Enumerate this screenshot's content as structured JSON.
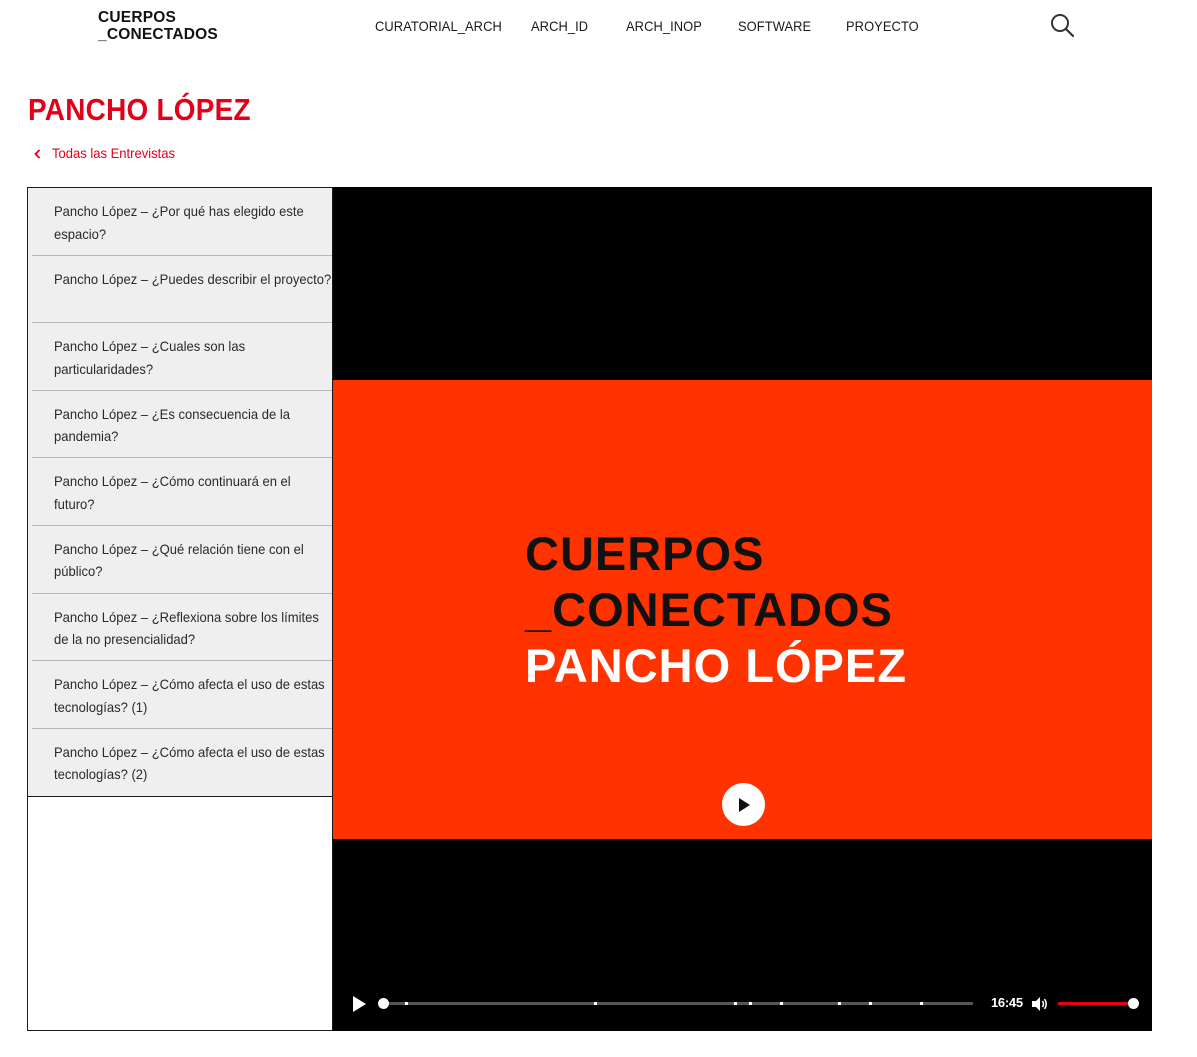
{
  "header": {
    "logo_line1": "CUERPOS",
    "logo_line2": "_CONECTADOS",
    "nav": [
      "CURATORIAL_ARCH",
      "ARCH_ID",
      "ARCH_INOP",
      "SOFTWARE",
      "PROYECTO"
    ],
    "search_icon": "search-icon"
  },
  "page": {
    "title": "PANCHO LÓPEZ",
    "back_label": "Todas las Entrevistas"
  },
  "sidebar": {
    "items": [
      "Pancho López – ¿Por qué has elegido este espacio?",
      "Pancho López – ¿Puedes describir el proyecto?",
      "Pancho López – ¿Cuales son las particularidades?",
      "Pancho López – ¿Es consecuencia de la pandemia?",
      "Pancho López – ¿Cómo continuará en el futuro?",
      "Pancho López – ¿Qué relación tiene con el público?",
      "Pancho López – ¿Reflexiona sobre los límites de la no presencialidad?",
      "Pancho López – ¿Cómo afecta el uso de estas tecnologías? (1)",
      "Pancho López – ¿Cómo afecta el uso de estas tecnologías? (2)"
    ]
  },
  "video": {
    "slide_line1": "CUERPOS",
    "slide_line2": "_CONECTADOS",
    "slide_line3": "PANCHO LÓPEZ",
    "duration": "16:45",
    "progress": 0,
    "volume": 1.0,
    "colors": {
      "slide_bg": "#ff3300",
      "accent": "#e2001a"
    }
  }
}
